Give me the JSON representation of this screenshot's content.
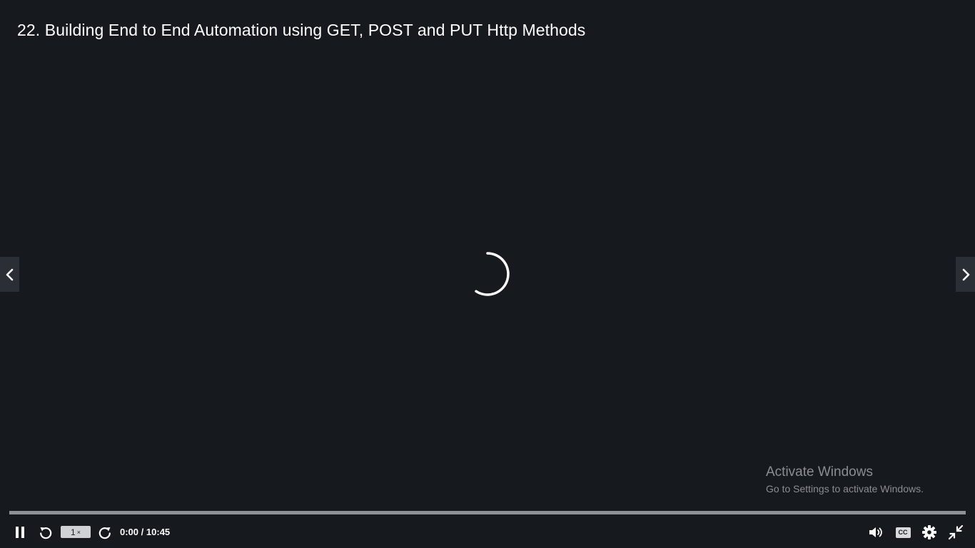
{
  "lecture": {
    "title": "22. Building End to End Automation using GET, POST and PUT Http Methods"
  },
  "navigation": {
    "prev_icon": "chevron-left-icon",
    "next_icon": "chevron-right-icon"
  },
  "playback": {
    "state": "loading",
    "speed_value": "1",
    "speed_suffix": "×",
    "current_time": "0:00",
    "separator": "/",
    "duration": "10:45",
    "progress_fraction": 0
  },
  "controls": {
    "play_pause_icon": "pause-icon",
    "rewind_icon": "rewind-icon",
    "forward_icon": "forward-icon",
    "volume_icon": "volume-icon",
    "captions_label": "CC",
    "settings_icon": "gear-icon",
    "exit_fullscreen_icon": "exit-fullscreen-icon"
  },
  "watermark": {
    "title": "Activate Windows",
    "subtitle": "Go to Settings to activate Windows."
  },
  "colors": {
    "background": "#16191e",
    "track": "#8e9196",
    "nav_button": "#2a2f36",
    "watermark_text": "#8a8d92"
  }
}
